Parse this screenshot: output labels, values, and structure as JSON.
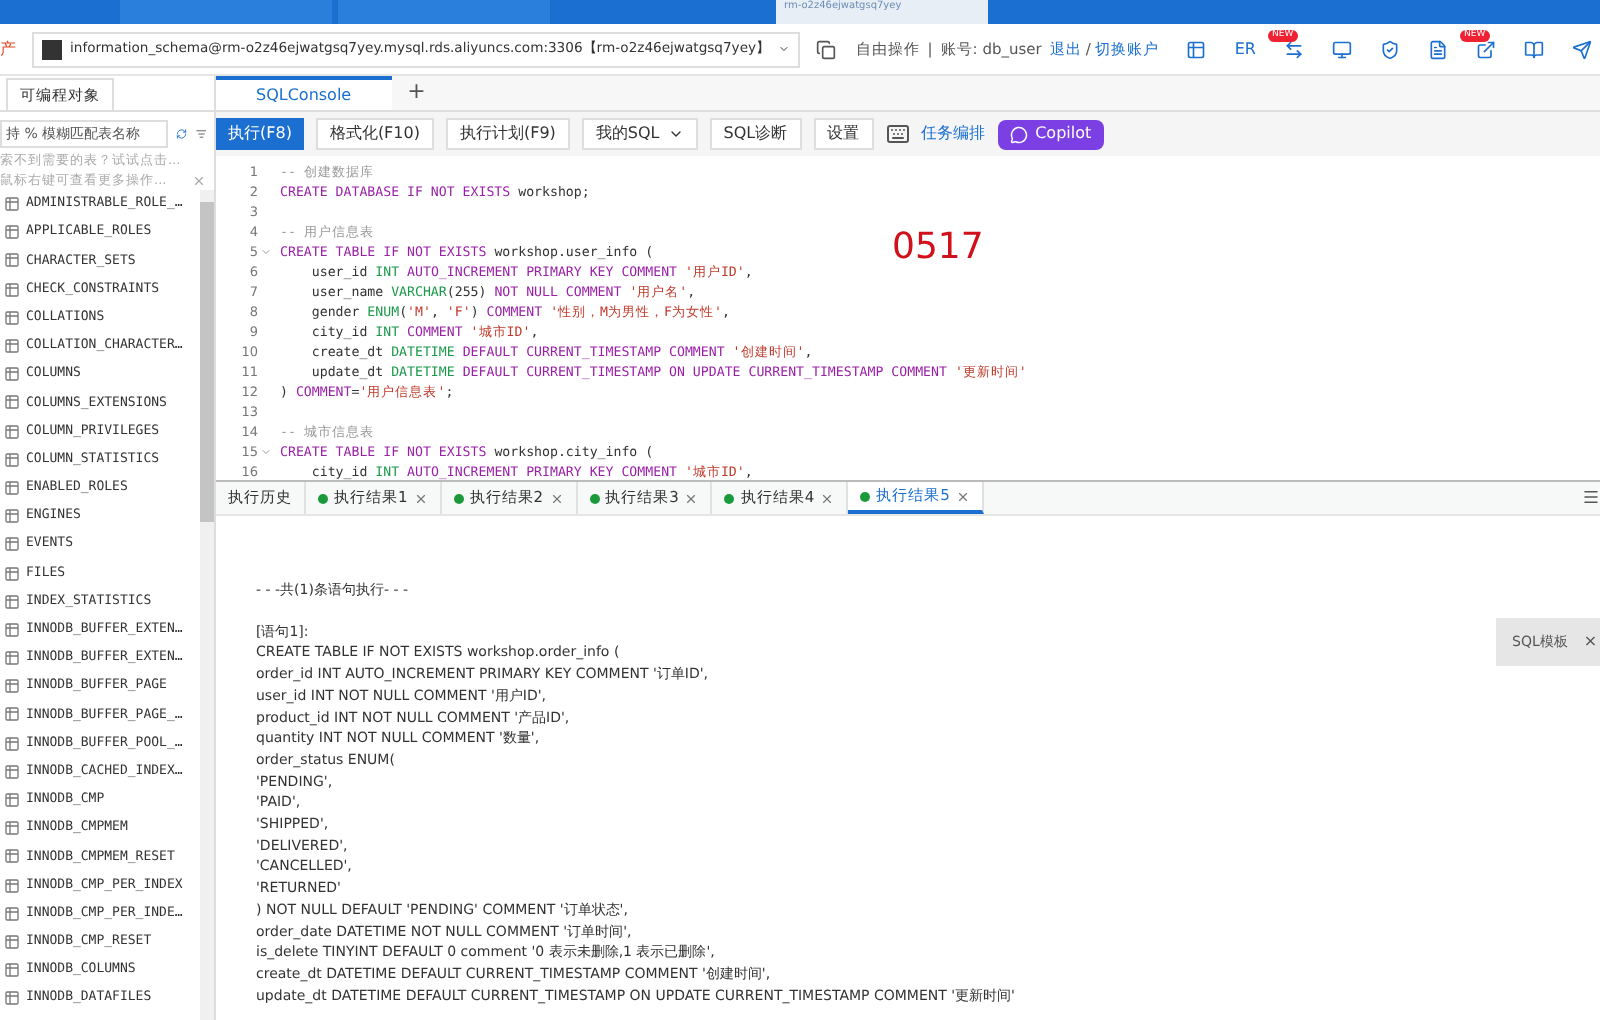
{
  "browser_tabs": [
    {
      "selected": false
    },
    {
      "selected": false
    },
    {
      "label": "rm-o2z46ejwatgsq7yey",
      "selected": true
    }
  ],
  "connection": {
    "env_tag": "产",
    "value": "information_schema@rm-o2z46ejwatgsq7yey.mysql.rds.aliyuncs.com:3306【rm-o2z46ejwatgsq7yey】"
  },
  "account": {
    "mode": "自由操作",
    "divider": "|",
    "label": "账号: db_user",
    "logout": "退出",
    "separator": "/",
    "switch": "切换账户"
  },
  "top_icons": [
    {
      "kind": "table"
    },
    {
      "kind": "er",
      "text": "ER"
    },
    {
      "kind": "sync",
      "badge": "NEW"
    },
    {
      "kind": "monitor"
    },
    {
      "kind": "shield"
    },
    {
      "kind": "doc"
    },
    {
      "kind": "export",
      "badge": "NEW"
    },
    {
      "kind": "book"
    },
    {
      "kind": "send"
    }
  ],
  "sidebar": {
    "tab": "可编程对象",
    "search_placeholder": "持 % 模糊匹配表名称",
    "hint1": "索不到需要的表？试试点击...",
    "hint2": "鼠标右键可查看更多操作...",
    "items": [
      "ADMINISTRABLE_ROLE_…",
      "APPLICABLE_ROLES",
      "CHARACTER_SETS",
      "CHECK_CONSTRAINTS",
      "COLLATIONS",
      "COLLATION_CHARACTER…",
      "COLUMNS",
      "COLUMNS_EXTENSIONS",
      "COLUMN_PRIVILEGES",
      "COLUMN_STATISTICS",
      "ENABLED_ROLES",
      "ENGINES",
      "EVENTS",
      "FILES",
      "INDEX_STATISTICS",
      "INNODB_BUFFER_EXTEN…",
      "INNODB_BUFFER_EXTEN…",
      "INNODB_BUFFER_PAGE",
      "INNODB_BUFFER_PAGE_…",
      "INNODB_BUFFER_POOL_…",
      "INNODB_CACHED_INDEX…",
      "INNODB_CMP",
      "INNODB_CMPMEM",
      "INNODB_CMPMEM_RESET",
      "INNODB_CMP_PER_INDEX",
      "INNODB_CMP_PER_INDE…",
      "INNODB_CMP_RESET",
      "INNODB_COLUMNS",
      "INNODB_DATAFILES"
    ]
  },
  "editor_tabs": [
    {
      "label": "SQLConsole",
      "selected": true
    },
    {
      "label": "+",
      "selected": false
    }
  ],
  "toolbar": [
    {
      "kind": "primary",
      "label": "执行(F8)"
    },
    {
      "kind": "button",
      "label": "格式化(F10)"
    },
    {
      "kind": "button",
      "label": "执行计划(F9)"
    },
    {
      "kind": "dropdown",
      "label": "我的SQL"
    },
    {
      "kind": "button",
      "label": "SQL诊断"
    },
    {
      "kind": "button",
      "label": "设置"
    },
    {
      "kind": "icon"
    },
    {
      "kind": "link",
      "label": "任务编排"
    },
    {
      "kind": "copilot",
      "label": "Copilot"
    }
  ],
  "annotation": "0517",
  "code": [
    {
      "n": "1",
      "fold": false,
      "segs": [
        {
          "kind": "comment",
          "t": "-- 创建数据库"
        }
      ]
    },
    {
      "n": "2",
      "fold": false,
      "segs": [
        {
          "kind": "kw",
          "t": "CREATE DATABASE IF NOT EXISTS "
        },
        {
          "kind": "plain",
          "t": "workshop;"
        }
      ]
    },
    {
      "n": "3",
      "fold": false
    },
    {
      "n": "4",
      "fold": false,
      "segs": [
        {
          "kind": "comment",
          "t": "-- 用户信息表"
        }
      ]
    },
    {
      "n": "5",
      "fold": true,
      "segs": [
        {
          "kind": "kw",
          "t": "CREATE TABLE IF NOT EXISTS "
        },
        {
          "kind": "plain",
          "t": "workshop.user_info ("
        }
      ]
    },
    {
      "n": "6",
      "fold": false,
      "segs": [
        {
          "kind": "plain",
          "t": "    user_id "
        },
        {
          "kind": "type",
          "t": "INT "
        },
        {
          "kind": "kw",
          "t": "AUTO_INCREMENT PRIMARY KEY COMMENT "
        },
        {
          "kind": "str",
          "t": "'用户ID'"
        },
        {
          "kind": "plain",
          "t": ","
        }
      ]
    },
    {
      "n": "7",
      "fold": false,
      "segs": [
        {
          "kind": "plain",
          "t": "    user_name "
        },
        {
          "kind": "type",
          "t": "VARCHAR"
        },
        {
          "kind": "plain",
          "t": "(255) "
        },
        {
          "kind": "kw",
          "t": "NOT NULL COMMENT "
        },
        {
          "kind": "str",
          "t": "'用户名'"
        },
        {
          "kind": "plain",
          "t": ","
        }
      ]
    },
    {
      "n": "8",
      "fold": false,
      "segs": [
        {
          "kind": "plain",
          "t": "    gender "
        },
        {
          "kind": "type",
          "t": "ENUM"
        },
        {
          "kind": "plain",
          "t": "("
        },
        {
          "kind": "str",
          "t": "'M'"
        },
        {
          "kind": "plain",
          "t": ", "
        },
        {
          "kind": "str",
          "t": "'F'"
        },
        {
          "kind": "plain",
          "t": ") "
        },
        {
          "kind": "kw",
          "t": "COMMENT "
        },
        {
          "kind": "str",
          "t": "'性别，M为男性，F为女性'"
        },
        {
          "kind": "plain",
          "t": ","
        }
      ]
    },
    {
      "n": "9",
      "fold": false,
      "segs": [
        {
          "kind": "plain",
          "t": "    city_id "
        },
        {
          "kind": "type",
          "t": "INT "
        },
        {
          "kind": "kw",
          "t": "COMMENT "
        },
        {
          "kind": "str",
          "t": "'城市ID'"
        },
        {
          "kind": "plain",
          "t": ","
        }
      ]
    },
    {
      "n": "10",
      "fold": false,
      "segs": [
        {
          "kind": "plain",
          "t": "    create_dt "
        },
        {
          "kind": "type",
          "t": "DATETIME "
        },
        {
          "kind": "kw",
          "t": "DEFAULT CURRENT_TIMESTAMP COMMENT "
        },
        {
          "kind": "str",
          "t": "'创建时间'"
        },
        {
          "kind": "plain",
          "t": ","
        }
      ]
    },
    {
      "n": "11",
      "fold": false,
      "segs": [
        {
          "kind": "plain",
          "t": "    update_dt "
        },
        {
          "kind": "type",
          "t": "DATETIME "
        },
        {
          "kind": "kw",
          "t": "DEFAULT CURRENT_TIMESTAMP ON UPDATE CURRENT_TIMESTAMP COMMENT "
        },
        {
          "kind": "str",
          "t": "'更新时间'"
        }
      ]
    },
    {
      "n": "12",
      "fold": false,
      "segs": [
        {
          "kind": "plain",
          "t": ") "
        },
        {
          "kind": "kw",
          "t": "COMMENT"
        },
        {
          "kind": "plain",
          "t": "="
        },
        {
          "kind": "str",
          "t": "'用户信息表'"
        },
        {
          "kind": "plain",
          "t": ";"
        }
      ]
    },
    {
      "n": "13",
      "fold": false
    },
    {
      "n": "14",
      "fold": false,
      "segs": [
        {
          "kind": "comment",
          "t": "-- 城市信息表"
        }
      ]
    },
    {
      "n": "15",
      "fold": true,
      "segs": [
        {
          "kind": "kw",
          "t": "CREATE TABLE IF NOT EXISTS "
        },
        {
          "kind": "plain",
          "t": "workshop.city_info ("
        }
      ]
    },
    {
      "n": "16",
      "fold": false,
      "segs": [
        {
          "kind": "plain",
          "t": "    city_id "
        },
        {
          "kind": "type",
          "t": "INT "
        },
        {
          "kind": "kw",
          "t": "AUTO_INCREMENT PRIMARY KEY COMMENT "
        },
        {
          "kind": "str",
          "t": "'城市ID'"
        },
        {
          "kind": "plain",
          "t": ","
        }
      ]
    }
  ],
  "result_tabs": [
    {
      "label": "执行历史",
      "dot": false,
      "closable": false,
      "selected": false
    },
    {
      "label": "执行结果1",
      "dot": true,
      "closable": true,
      "selected": false
    },
    {
      "label": "执行结果2",
      "dot": true,
      "closable": true,
      "selected": false
    },
    {
      "label": "执行结果3",
      "dot": true,
      "closable": true,
      "selected": false
    },
    {
      "label": "执行结果4",
      "dot": true,
      "closable": true,
      "selected": false
    },
    {
      "label": "执行结果5",
      "dot": true,
      "closable": true,
      "selected": true
    }
  ],
  "output": {
    "summary": "- - -共(1)条语句执行- - -",
    "lines": [
      "[语句1]:",
      "CREATE TABLE IF NOT EXISTS workshop.order_info (",
      "order_id INT AUTO_INCREMENT PRIMARY KEY COMMENT '订单ID',",
      "user_id INT NOT NULL COMMENT '用户ID',",
      "product_id INT NOT NULL COMMENT '产品ID',",
      "quantity INT NOT NULL COMMENT '数量',",
      "order_status ENUM(",
      "'PENDING',",
      "'PAID',",
      "'SHIPPED',",
      "'DELIVERED',",
      "'CANCELLED',",
      "'RETURNED'",
      ") NOT NULL DEFAULT 'PENDING' COMMENT '订单状态',",
      "order_date DATETIME NOT NULL COMMENT '订单时间',",
      "is_delete TINYINT DEFAULT 0 comment '0 表示未删除,1 表示已删除',",
      "create_dt DATETIME DEFAULT CURRENT_TIMESTAMP COMMENT '创建时间',",
      "update_dt DATETIME DEFAULT CURRENT_TIMESTAMP ON UPDATE CURRENT_TIMESTAMP COMMENT '更新时间'"
    ]
  },
  "sql_template": {
    "label": "SQL模板",
    "close": "×"
  }
}
